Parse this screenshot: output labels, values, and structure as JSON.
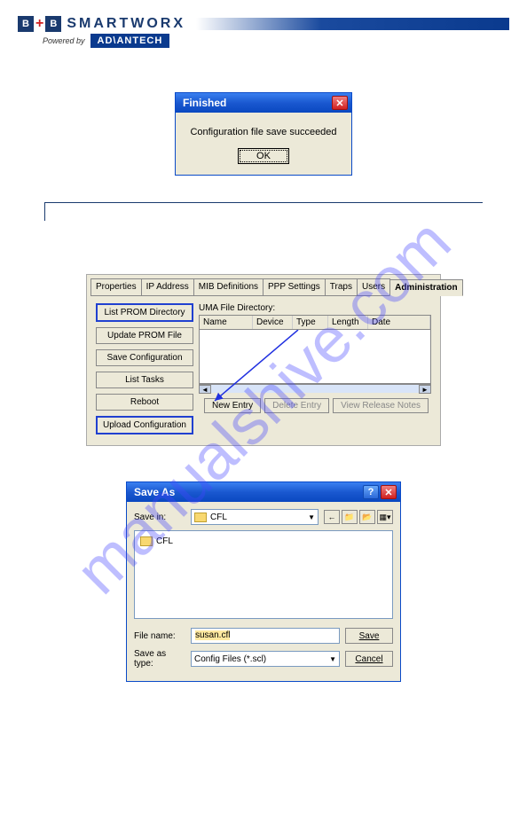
{
  "watermark": "manualshive.com",
  "header": {
    "brand_prefix": "B",
    "brand_plus": "+",
    "brand_suffix": "B",
    "brand_text": "SMARTWORX",
    "powered_by": "Powered by",
    "advantech": "AD\\ANTECH"
  },
  "dialog_finished": {
    "title": "Finished",
    "message": "Configuration file save succeeded",
    "ok": "OK"
  },
  "tabs_panel": {
    "tabs": [
      "Properties",
      "IP Address",
      "MIB Definitions",
      "PPP Settings",
      "Traps",
      "Users",
      "Administration"
    ],
    "active_tab_index": 6,
    "left_buttons": [
      "List PROM Directory",
      "Update PROM File",
      "Save Configuration",
      "List Tasks",
      "Reboot",
      "Upload Configuration"
    ],
    "pane_label": "UMA File Directory:",
    "file_headers": [
      "Name",
      "Device",
      "Type",
      "Length",
      "Date"
    ],
    "bottom_buttons": [
      {
        "label": "New Entry",
        "disabled": false
      },
      {
        "label": "Delete Entry",
        "disabled": true
      },
      {
        "label": "View Release Notes",
        "disabled": true
      }
    ]
  },
  "dialog_save": {
    "title": "Save As",
    "save_in_label": "Save in:",
    "save_in_value": "CFL",
    "file_items": [
      "CFL"
    ],
    "filename_label": "File name:",
    "filename_value": "susan.cfl",
    "saveastype_label": "Save as type:",
    "saveastype_value": "Config Files (*.scl)",
    "save_btn": "Save",
    "cancel_btn": "Cancel"
  }
}
